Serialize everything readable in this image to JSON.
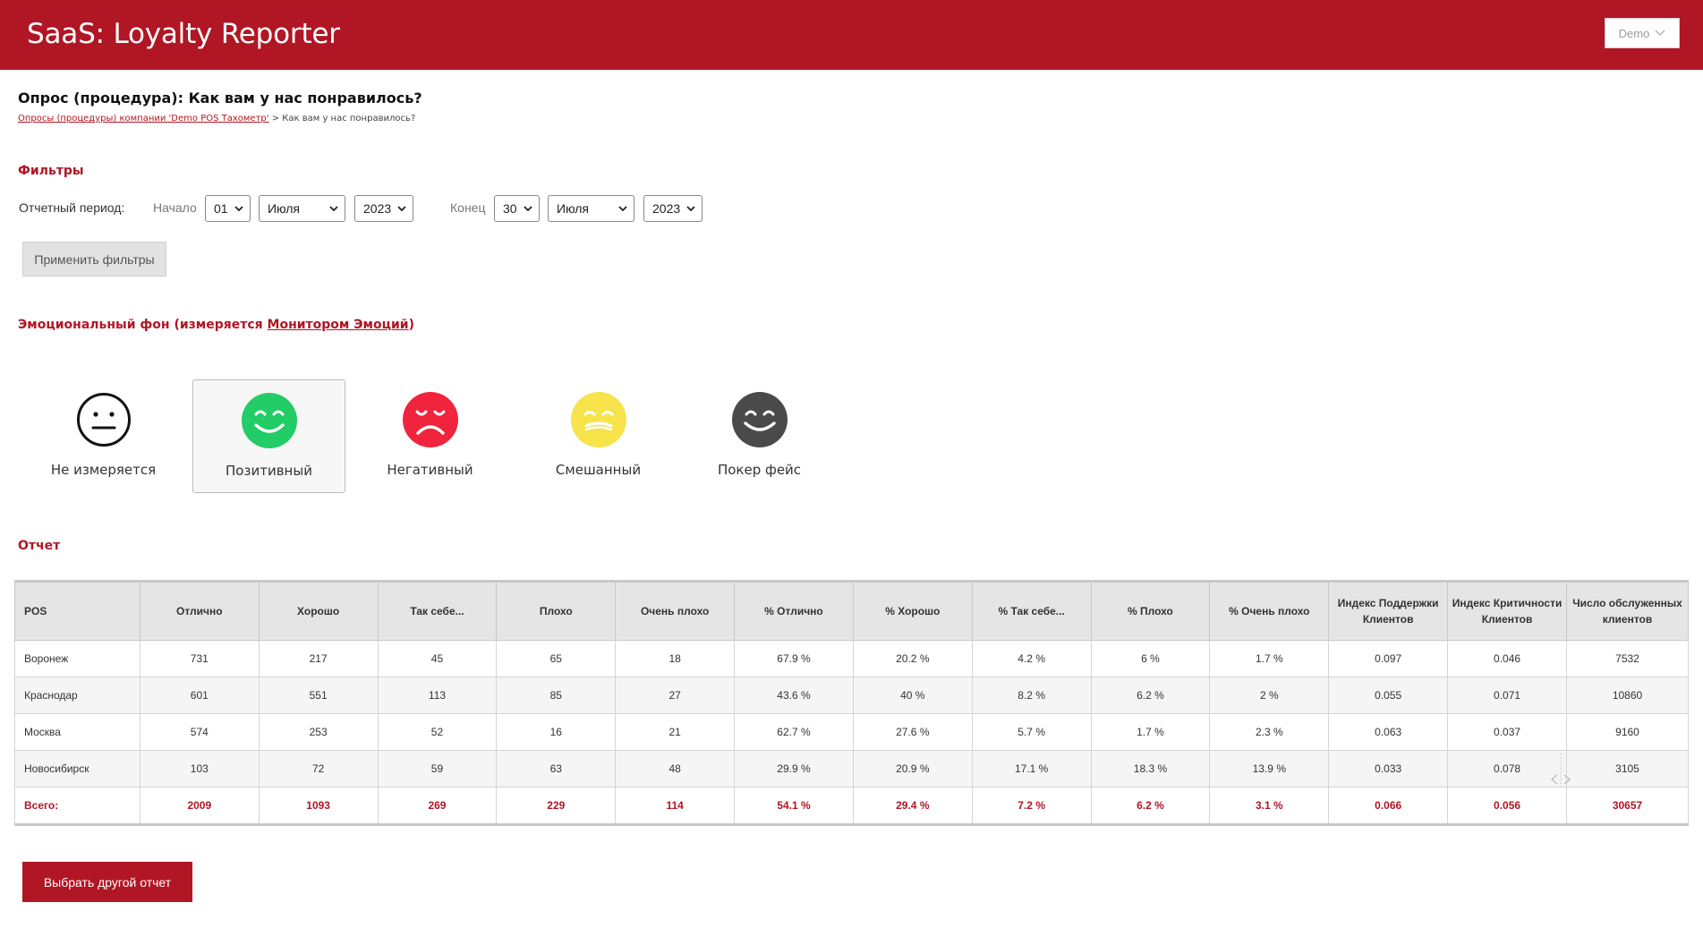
{
  "header": {
    "app_title": "SaaS: Loyalty Reporter",
    "user_label": "Demo"
  },
  "page": {
    "title": "Опрос (процедура): Как вам у нас понравилось?",
    "breadcrumb_link": "Опросы (процедуры) компании 'Demo POS Тахометр'",
    "breadcrumb_sep": " > ",
    "breadcrumb_current": "Как вам у нас понравилось?"
  },
  "filters": {
    "heading": "Фильтры",
    "period_label": "Отчетный период:",
    "start_label": "Начало",
    "start_day": "01",
    "start_month": "Июля",
    "start_year": "2023",
    "end_label": "Конец",
    "end_day": "30",
    "end_month": "Июля",
    "end_year": "2023",
    "apply_label": "Применить фильтры"
  },
  "emotions": {
    "heading_prefix": "Эмоциональный фон (измеряется ",
    "heading_link": "Монитором Эмоций",
    "heading_suffix": ")",
    "items": [
      {
        "label": "Не измеряется",
        "color": "#ffffff",
        "selected": false
      },
      {
        "label": "Позитивный",
        "color": "#22cc66",
        "selected": true
      },
      {
        "label": "Негативный",
        "color": "#f0243c",
        "selected": false
      },
      {
        "label": "Смешанный",
        "color": "#f7e34a",
        "selected": false
      },
      {
        "label": "Покер фейс",
        "color": "#4a4a4a",
        "selected": false
      }
    ]
  },
  "report": {
    "heading": "Отчет",
    "columns": [
      "POS",
      "Отлично",
      "Хорошо",
      "Так себе...",
      "Плохо",
      "Очень плохо",
      "% Отлично",
      "% Хорошо",
      "% Так себе...",
      "% Плохо",
      "% Очень плохо",
      "Индекс Поддержки Клиентов",
      "Индекс Критичности Клиентов",
      "Число обслуженных клиентов"
    ],
    "rows": [
      [
        "Воронеж",
        "731",
        "217",
        "45",
        "65",
        "18",
        "67.9 %",
        "20.2 %",
        "4.2 %",
        "6 %",
        "1.7 %",
        "0.097",
        "0.046",
        "7532"
      ],
      [
        "Краснодар",
        "601",
        "551",
        "113",
        "85",
        "27",
        "43.6 %",
        "40 %",
        "8.2 %",
        "6.2 %",
        "2 %",
        "0.055",
        "0.071",
        "10860"
      ],
      [
        "Москва",
        "574",
        "253",
        "52",
        "16",
        "21",
        "62.7 %",
        "27.6 %",
        "5.7 %",
        "1.7 %",
        "2.3 %",
        "0.063",
        "0.037",
        "9160"
      ],
      [
        "Новосибирск",
        "103",
        "72",
        "59",
        "63",
        "48",
        "29.9 %",
        "20.9 %",
        "17.1 %",
        "18.3 %",
        "13.9 %",
        "0.033",
        "0.078",
        "3105"
      ]
    ],
    "total": [
      "Всего:",
      "2009",
      "1093",
      "269",
      "229",
      "114",
      "54.1 %",
      "29.4 %",
      "7.2 %",
      "6.2 %",
      "3.1 %",
      "0.066",
      "0.056",
      "30657"
    ]
  },
  "actions": {
    "other_report_label": "Выбрать другой отчет"
  },
  "colors": {
    "brand": "#b01624"
  }
}
